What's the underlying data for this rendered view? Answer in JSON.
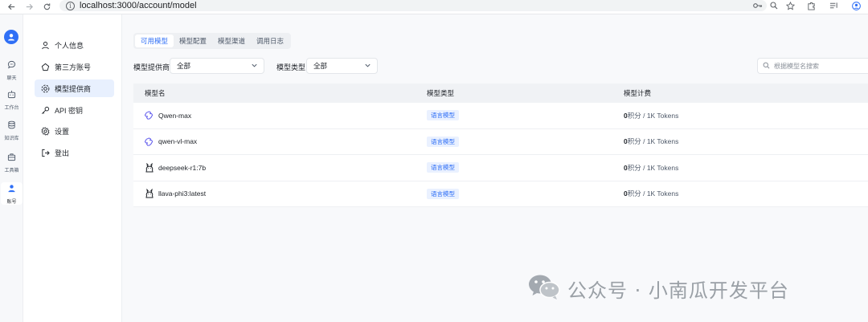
{
  "browser": {
    "url": "localhost:3000/account/model"
  },
  "rail": {
    "items": [
      {
        "label": "聊天",
        "icon": "chat-icon"
      },
      {
        "label": "工作台",
        "icon": "robot-icon"
      },
      {
        "label": "知识库",
        "icon": "database-icon"
      },
      {
        "label": "工具箱",
        "icon": "toolbox-icon"
      },
      {
        "label": "账号",
        "icon": "user-icon",
        "active": true
      }
    ]
  },
  "menu": {
    "items": [
      {
        "label": "个人信息",
        "icon": "user-icon"
      },
      {
        "label": "第三方账号",
        "icon": "cloud-icon"
      },
      {
        "label": "模型提供商",
        "icon": "model-icon",
        "active": true
      },
      {
        "label": "API 密钥",
        "icon": "key-icon"
      },
      {
        "label": "设置",
        "icon": "gear-icon"
      },
      {
        "label": "登出",
        "icon": "logout-icon"
      }
    ]
  },
  "tabs": [
    {
      "label": "可用模型",
      "active": true
    },
    {
      "label": "模型配置"
    },
    {
      "label": "模型渠道"
    },
    {
      "label": "调用日志"
    }
  ],
  "filters": {
    "provider_label": "模型提供商",
    "provider_value": "全部",
    "type_label": "模型类型",
    "type_value": "全部",
    "search_placeholder": "根据模型名搜索"
  },
  "table": {
    "headers": [
      "模型名",
      "模型类型",
      "模型计费"
    ],
    "rows": [
      {
        "name": "Qwen-max",
        "provider_icon": "qwen-icon",
        "type": "语言模型",
        "price": "0",
        "price_unit": "积分 / 1K Tokens"
      },
      {
        "name": "qwen-vl-max",
        "provider_icon": "qwen-icon",
        "type": "语言模型",
        "price": "0",
        "price_unit": "积分 / 1K Tokens"
      },
      {
        "name": "deepseek-r1:7b",
        "provider_icon": "ollama-icon",
        "type": "语言模型",
        "price": "0",
        "price_unit": "积分 / 1K Tokens"
      },
      {
        "name": "llava-phi3:latest",
        "provider_icon": "ollama-icon",
        "type": "语言模型",
        "price": "0",
        "price_unit": "积分 / 1K Tokens"
      }
    ]
  },
  "watermark": {
    "text": "公众号 · 小南瓜开发平台"
  },
  "colors": {
    "accent": "#2f6ff6",
    "active_menu_bg": "#e8f0fe",
    "badge_bg": "#eaf1ff"
  }
}
